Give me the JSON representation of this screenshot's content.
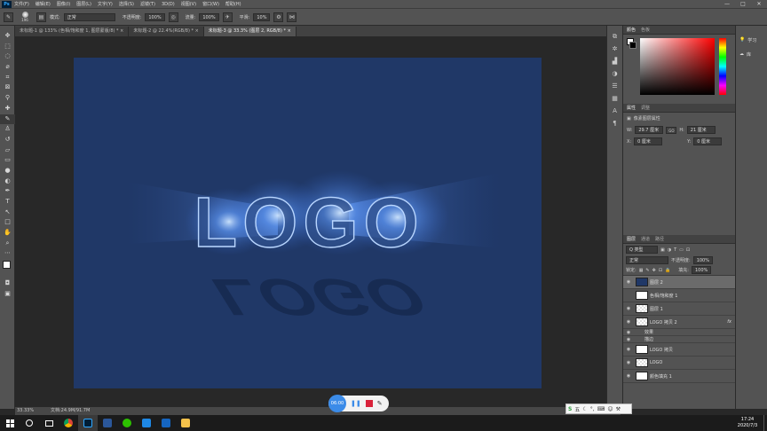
{
  "menubar": {
    "app_logo": "Ps",
    "items": [
      "文件(F)",
      "编辑(E)",
      "图像(I)",
      "图层(L)",
      "文字(Y)",
      "选择(S)",
      "滤镜(T)",
      "3D(D)",
      "视图(V)",
      "窗口(W)",
      "帮助(H)"
    ],
    "win_controls": [
      "—",
      "□",
      "✕"
    ]
  },
  "options": {
    "brush_size": "196",
    "mode_label": "模式:",
    "mode_value": "正常",
    "opacity_label": "不透明度:",
    "opacity_value": "100%",
    "flow_label": "流量:",
    "flow_value": "100%",
    "smooth_label": "平滑:",
    "smooth_value": "10%"
  },
  "tabs": [
    "未标题-1 @ 133% (色相/饱和度 1, 图层蒙版/8) * ×",
    "未标题-2 @ 22.4%(RGB/8) * ×",
    "未标题-3 @ 33.3% (图层 2, RGB/8) * ×"
  ],
  "canvas": {
    "logo_text": "LOGO",
    "background_color": "#203867"
  },
  "status": {
    "zoom": "33.33%",
    "doc": "文档:24.9M/91.7M"
  },
  "recorder": {
    "timer": "06:00",
    "pause_icon": "pause-icon",
    "stop_icon": "stop-icon",
    "pen_icon": "pen-icon"
  },
  "panels": {
    "color_tabs": [
      "颜色",
      "色板"
    ],
    "properties_tabs": [
      "属性",
      "调整"
    ],
    "properties_title": "像素图层属性",
    "w_label": "W:",
    "w_value": "29.7 厘米",
    "link_icon": "GO",
    "h_label": "H:",
    "h_value": "21 厘米",
    "x_label": "X:",
    "x_value": "0 厘米",
    "y_label": "Y:",
    "y_value": "0 厘米",
    "layers_tabs": [
      "图层",
      "通道",
      "路径"
    ],
    "filter_label": "Q 类型",
    "blend_mode": "正常",
    "layer_opacity_label": "不透明度:",
    "layer_opacity_value": "100%",
    "lock_label": "锁定:",
    "fill_label": "填充:",
    "fill_value": "100%"
  },
  "layers": [
    {
      "name": "图层 2",
      "thumb": "blue",
      "selected": true,
      "visible": true
    },
    {
      "name": "色相/饱和度 1",
      "thumb": "white",
      "selected": false,
      "visible": false
    },
    {
      "name": "图层 1",
      "thumb": "checker",
      "selected": false,
      "visible": true
    },
    {
      "name": "LOGO 拷贝 2",
      "thumb": "checker",
      "selected": false,
      "visible": true,
      "fx": "fx"
    },
    {
      "name": "效果",
      "thumb": "none",
      "selected": false,
      "visible": true,
      "sub": true
    },
    {
      "name": "描边",
      "thumb": "none",
      "selected": false,
      "visible": true,
      "sub": true
    },
    {
      "name": "LOGO 拷贝",
      "thumb": "white",
      "selected": false,
      "visible": true
    },
    {
      "name": "LOGO",
      "thumb": "checker",
      "selected": false,
      "visible": true
    },
    {
      "name": "颜色填充 1",
      "thumb": "white",
      "selected": false,
      "visible": true
    }
  ],
  "far_right": {
    "learn_label": "学习",
    "library_label": "库"
  },
  "ime_tray": {
    "label": "五"
  },
  "taskbar": {
    "time": "17:24",
    "date": "2020/7/3"
  }
}
